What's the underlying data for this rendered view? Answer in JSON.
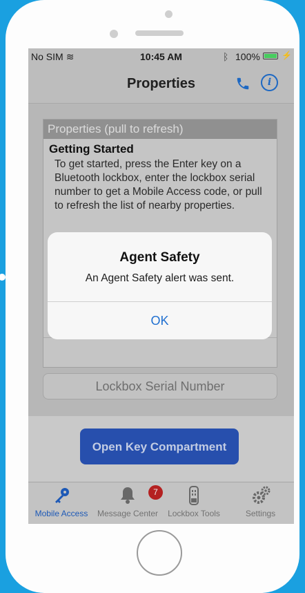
{
  "status": {
    "carrier": "No SIM",
    "time": "10:45 AM",
    "battery": "100%",
    "battery_level_percent": 100
  },
  "nav": {
    "title": "Properties"
  },
  "panel": {
    "header": "Properties (pull to refresh)",
    "item_title": "Getting Started",
    "item_body": "To get started, press the Enter key on a Bluetooth lockbox, enter the lockbox serial number to get a Mobile Access code, or pull to refresh the list of nearby properties."
  },
  "serial_input": {
    "placeholder": "Lockbox Serial Number",
    "value": ""
  },
  "actions": {
    "open_key_label": "Open Key Compartment"
  },
  "tabs": [
    {
      "label": "Mobile Access",
      "icon": "key-icon",
      "active": true
    },
    {
      "label": "Message Center",
      "icon": "bell-icon",
      "badge": "7"
    },
    {
      "label": "Lockbox Tools",
      "icon": "lockbox-icon"
    },
    {
      "label": "Settings",
      "icon": "gears-icon"
    }
  ],
  "alert": {
    "title": "Agent Safety",
    "message": "An Agent Safety alert was sent.",
    "ok_label": "OK"
  },
  "colors": {
    "accent": "#1f6fd0",
    "button": "#2a54b8",
    "badge": "#c02424",
    "background": "#1aa0e0"
  }
}
